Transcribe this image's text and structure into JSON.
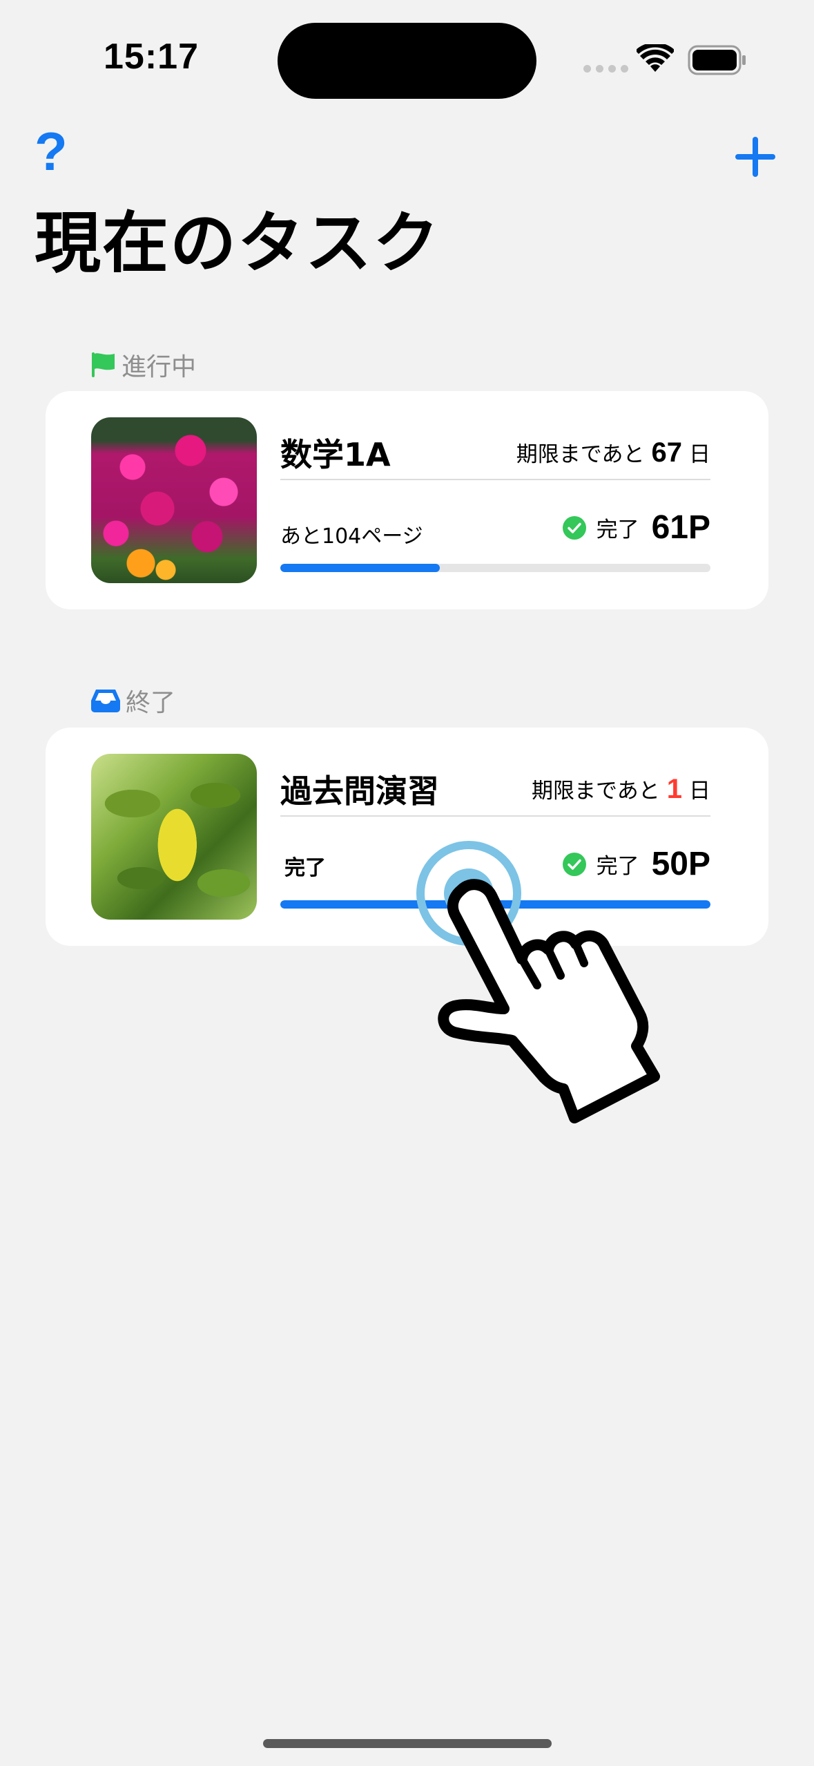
{
  "status_bar": {
    "time": "15:17",
    "icons": [
      "signal-dots-icon",
      "wifi-icon",
      "battery-icon"
    ]
  },
  "nav": {
    "help_label": "?",
    "add_icon": "plus-icon"
  },
  "page_title": "現在のタスク",
  "colors": {
    "accent": "#1479f2",
    "in_progress_flag": "#34c759",
    "check": "#34c759",
    "urgent": "#ff3b30",
    "background": "#f2f2f2",
    "track": "#e5e5e5"
  },
  "sections": {
    "in_progress": {
      "icon": "flag-icon",
      "label": "進行中",
      "tasks": [
        {
          "title": "数学1A",
          "image": "pink-flowers-photo",
          "deadline_prefix": "期限まであと",
          "days": "67",
          "days_suffix": "日",
          "remaining": "あと104ページ",
          "status_label": "完了",
          "pages": "61P",
          "progress": 0.37
        }
      ]
    },
    "finished": {
      "icon": "tray-icon",
      "label": "終了",
      "tasks": [
        {
          "title": "過去問演習",
          "image": "green-leaves-photo",
          "deadline_prefix": "期限まであと",
          "days": "1",
          "days_suffix": "日",
          "remaining": "完了",
          "status_label": "完了",
          "pages": "50P",
          "progress": 1.0
        }
      ]
    }
  },
  "overlay": {
    "icons": [
      "touch-indicator-icon",
      "pointing-hand-icon"
    ]
  }
}
